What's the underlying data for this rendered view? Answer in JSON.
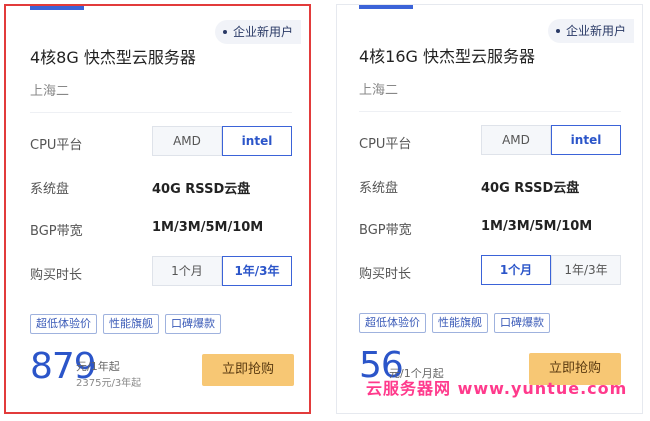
{
  "cards": [
    {
      "badge": "企业新用户",
      "title": "4核8G 快杰型云服务器",
      "region": "上海二",
      "cpu_label": "CPU平台",
      "cpu_options": [
        "AMD",
        "intel"
      ],
      "disk_label": "系统盘",
      "disk_value": "40G RSSD云盘",
      "bandwidth_label": "BGP带宽",
      "bandwidth_value": "1M/3M/5M/10M",
      "duration_label": "购买时长",
      "duration_options": [
        "1个月",
        "1年/3年"
      ],
      "tags": [
        "超低体验价",
        "性能旗舰",
        "口碑爆款"
      ],
      "price": "879",
      "price_unit": "元/1年起",
      "price_sub": "2375元/3年起",
      "buy_label": "立即抢购"
    },
    {
      "badge": "企业新用户",
      "title": "4核16G 快杰型云服务器",
      "region": "上海二",
      "cpu_label": "CPU平台",
      "cpu_options": [
        "AMD",
        "intel"
      ],
      "disk_label": "系统盘",
      "disk_value": "40G RSSD云盘",
      "bandwidth_label": "BGP带宽",
      "bandwidth_value": "1M/3M/5M/10M",
      "duration_label": "购买时长",
      "duration_options": [
        "1个月",
        "1年/3年"
      ],
      "tags": [
        "超低体验价",
        "性能旗舰",
        "口碑爆款"
      ],
      "price": "56",
      "price_unit": "元/1个月起",
      "buy_label": "立即抢购"
    }
  ],
  "watermark": "云服务器网 www.yuntue.com",
  "colors": {
    "accent": "#3b63d8",
    "buy": "#f7c774",
    "highlight_border": "#e23b3b",
    "watermark": "#ff3a8c"
  }
}
